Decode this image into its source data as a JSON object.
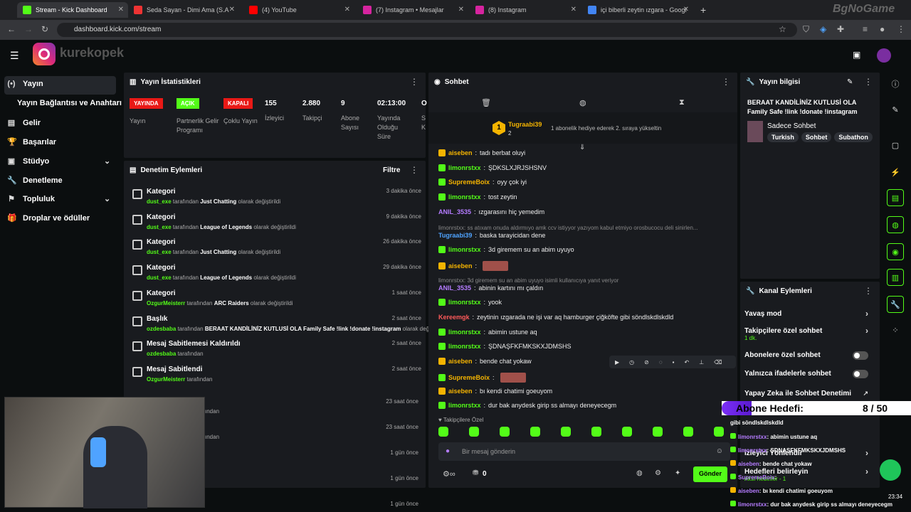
{
  "browser": {
    "tabs": [
      {
        "title": "Stream - Kick Dashboard",
        "color": "#53fc18"
      },
      {
        "title": "Seda Sayan - Dimi Ama (S.A",
        "color": "#e33"
      },
      {
        "title": "(4) YouTube",
        "color": "#f00"
      },
      {
        "title": "(7) Instagram • Mesajlar",
        "color": "#d6249f"
      },
      {
        "title": "(8) Instagram",
        "color": "#d6249f"
      },
      {
        "title": "içi biberli zeytin ızgara - Googl",
        "color": "#4285f4"
      }
    ],
    "url": "dashboard.kick.com/stream",
    "brand": "BgNoGame"
  },
  "header": {
    "logo_text": "kurekopek"
  },
  "sidebar": {
    "items": [
      {
        "label": "Yayın",
        "icon": "broadcast-icon"
      },
      {
        "label": "Yayın Bağlantısı ve Anahtarı",
        "icon": ""
      },
      {
        "label": "Gelir",
        "icon": "revenue-icon"
      },
      {
        "label": "Başarılar",
        "icon": "trophy-icon"
      },
      {
        "label": "Stüdyo",
        "icon": "studio-icon"
      },
      {
        "label": "Denetleme",
        "icon": "wrench-icon"
      },
      {
        "label": "Topluluk",
        "icon": "community-icon"
      },
      {
        "label": "Droplar ve ödüller",
        "icon": "gift-icon"
      }
    ]
  },
  "stats": {
    "title": "Yayın İstatistikleri",
    "badges": [
      {
        "text": "YAYINDA",
        "label": "Yayın",
        "color": "#e91916"
      },
      {
        "text": "AÇIK",
        "label": "Partnerlik Gelir Programı",
        "color": "#53fc18"
      },
      {
        "text": "KAPALI",
        "label": "Çoklu Yayın",
        "color": "#e91916"
      }
    ],
    "values": [
      {
        "v": "155",
        "l": "İzleyici"
      },
      {
        "v": "2.880",
        "l": "Takipçi"
      },
      {
        "v": "9",
        "l": "Abone Sayısı"
      },
      {
        "v": "02:13:00",
        "l": "Yayında Olduğu Süre"
      },
      {
        "v": "O",
        "l": "S K"
      }
    ]
  },
  "mod": {
    "title": "Denetim Eylemleri",
    "filter": "Filtre",
    "items": [
      {
        "title": "Kategori",
        "user": "dust_exe",
        "mid": "tarafından",
        "val": "Just Chatting",
        "tail": "olarak değiştirildi",
        "time": "3 dakika önce"
      },
      {
        "title": "Kategori",
        "user": "dust_exe",
        "mid": "tarafından",
        "val": "League of Legends",
        "tail": "olarak değiştirildi",
        "time": "9 dakika önce"
      },
      {
        "title": "Kategori",
        "user": "dust_exe",
        "mid": "tarafından",
        "val": "Just Chatting",
        "tail": "olarak değiştirildi",
        "time": "26 dakika önce"
      },
      {
        "title": "Kategori",
        "user": "dust_exe",
        "mid": "tarafından",
        "val": "League of Legends",
        "tail": "olarak değiştirildi",
        "time": "29 dakika önce"
      },
      {
        "title": "Kategori",
        "user": "OzgurMeisterr",
        "mid": "tarafından",
        "val": "ARC Raiders",
        "tail": "olarak değiştirildi",
        "time": "1 saat önce"
      },
      {
        "title": "Başlık",
        "user": "ozdesbaba",
        "mid": "tarafından",
        "val": "BERAAT KANDİLİNİZ KUTLUSİ OLA Family Safe !link !donate !instagram",
        "tail": "olarak değiştirildi",
        "time": "2 saat önce"
      },
      {
        "title": "Mesaj Sabitlemesi Kaldırıldı",
        "user": "ozdesbaba",
        "mid": "tarafından",
        "val": "",
        "tail": "",
        "time": "2 saat önce"
      },
      {
        "title": "Mesaj Sabitlendi",
        "user": "OzgurMeisterr",
        "mid": "tarafından",
        "val": "",
        "tail": "",
        "time": "2 saat önce"
      }
    ],
    "extra_times": [
      "23 saat önce",
      "23 saat önce",
      "1 gün önce",
      "1 gün önce",
      "1 gün önce"
    ],
    "extra_mids": [
      "ından",
      "ından"
    ]
  },
  "chat": {
    "title": "Sohbet",
    "gifter": {
      "rank": "1",
      "name": "Tugraabi39",
      "count": "2",
      "text": "1 abonelik hediye ederek 2. sıraya yükseltin"
    },
    "messages": [
      {
        "u": "aiseben",
        "c": "#f5b400",
        "t": "tadı berbat oluyi",
        "b": "cr"
      },
      {
        "u": "limonrstxx",
        "c": "#53fc18",
        "t": "ŞDKSLXJRJSHSNV",
        "b": "gb"
      },
      {
        "u": "SupremeBoix",
        "c": "#f5b400",
        "t": "oyy çok iyi",
        "b": "gb"
      },
      {
        "u": "limonrstxx",
        "c": "#53fc18",
        "t": "tost zeytin",
        "b": "gb"
      },
      {
        "u": "ANIL_3535",
        "c": "#b57cff",
        "t": "ızgarasını hiç yemedim",
        "b": ""
      },
      {
        "u": "Tugraabi39",
        "c": "#4fa3ff",
        "t": "baska tarayicidan dene",
        "b": "",
        "reply": "limonrstxx: ss atıxam onuda aldırmıyo amk ccv istiyyor yazıyom kabul etmiyo orosbucocu deli sinirlen..."
      },
      {
        "u": "limonrstxx",
        "c": "#53fc18",
        "t": "3d giremem su an abim uyuyo",
        "b": "gb"
      },
      {
        "u": "aiseben",
        "c": "#f5b400",
        "t": "",
        "b": "cr"
      },
      {
        "u": "ANIL_3535",
        "c": "#b57cff",
        "t": "abinin kartını mı çaldın",
        "b": "",
        "reply": "limonrstxx: 3d giremem su an abim uyuyo isimli kullanıcıya yanıt veriyor"
      },
      {
        "u": "limonrstxx",
        "c": "#53fc18",
        "t": "yook",
        "b": "gb"
      },
      {
        "u": "Kereemgk",
        "c": "#ff5a5a",
        "t": "zeytinin ızgarada ne işi var aq hamburger çiğköfte gibi söndlskdlskdld",
        "b": ""
      },
      {
        "u": "limonrstxx",
        "c": "#53fc18",
        "t": "abimin ustune aq",
        "b": "gb"
      },
      {
        "u": "limonrstxx",
        "c": "#53fc18",
        "t": "ŞDNAŞFKFMKSKXJDMSHS",
        "b": "gb"
      },
      {
        "u": "aiseben",
        "c": "#f5b400",
        "t": "bende chat yokaw",
        "b": "cr"
      },
      {
        "u": "SupremeBoix",
        "c": "#f5b400",
        "t": "",
        "b": "gb"
      },
      {
        "u": "aiseben",
        "c": "#f5b400",
        "t": "bı kendi chatimi goeuyom",
        "b": "cr"
      },
      {
        "u": "limonrstxx",
        "c": "#53fc18",
        "t": "dur bak anydesk girip ss almayı deneyecegm",
        "b": "gb"
      }
    ],
    "follower_label": "Takipçilere Özel",
    "input_placeholder": "Bir mesaj gönderin",
    "points": "0",
    "send": "Gönder"
  },
  "info": {
    "title": "Yayın bilgisi",
    "stream_title": "BERAAT KANDİLİNİZ KUTLUSİ OLA Family Safe !link !donate !instagram",
    "category": "Sadece Sohbet",
    "tags": [
      "Turkish",
      "Sohbet",
      "Subathon"
    ]
  },
  "channel": {
    "title": "Kanal Eylemleri",
    "items": [
      {
        "label": "Yavaş mod",
        "kind": "chev"
      },
      {
        "label": "Takipçilere özel sohbet",
        "sub": "1 dk.",
        "kind": "chev"
      },
      {
        "label": "Abonelere özel sohbet",
        "kind": "tog"
      },
      {
        "label": "Yalnızca ifadelerle sohbet",
        "kind": "tog"
      },
      {
        "label": "Yapay Zeka ile Sohbet Denetimi",
        "kind": "ext"
      },
      {
        "label": "İzleyici Yönlendir",
        "kind": "chev"
      },
      {
        "label": "Hedefleri belirleyin",
        "sub": "Aktif hedefler - 1",
        "kind": "chev"
      }
    ]
  },
  "overlay": {
    "goal_label": "Abone Hedefi:",
    "goal_value": "8 / 50",
    "lines": [
      {
        "u": "",
        "t": "gibi söndlskdlskdld",
        "b": ""
      },
      {
        "u": "limonrstxx",
        "t": "abimin ustune aq",
        "b": "gb"
      },
      {
        "u": "limonrstxx",
        "t": "ŞDNAŞFKFMKSKXJDMSHS",
        "b": "gb"
      },
      {
        "u": "aiseben",
        "t": "bende chat yokaw",
        "b": "cr"
      },
      {
        "u": "SupremeBoix",
        "t": "",
        "b": "gb"
      },
      {
        "u": "aiseben",
        "t": "bı kendi chatimi goeuyom",
        "b": "cr"
      },
      {
        "u": "limonrstxx",
        "t": "dur bak anydesk girip ss almayı deneyecegm",
        "b": "gb"
      }
    ],
    "clock": "23:34"
  },
  "colors": {
    "accent": "#53fc18",
    "panel": "#191b1f",
    "bg": "#0b0e0f"
  }
}
